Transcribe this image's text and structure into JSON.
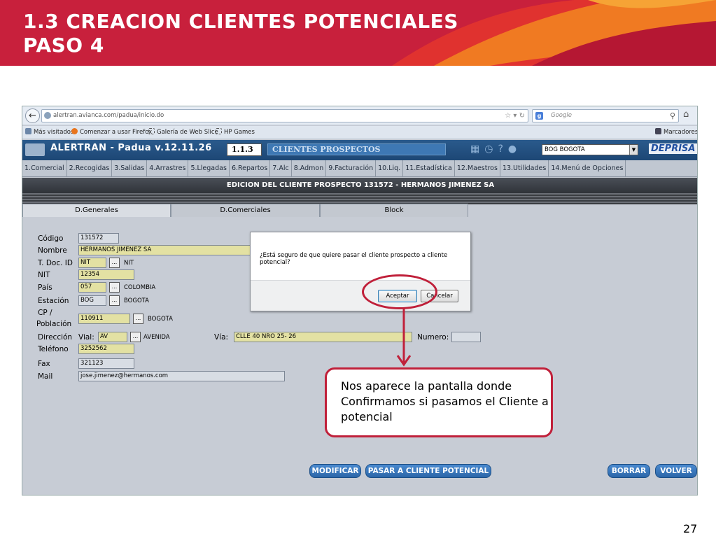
{
  "slide": {
    "title_line1": "1.3 CREACION CLIENTES POTENCIALES",
    "title_line2": "PASO 4",
    "page_number": "27",
    "annotation": "Nos aparece la pantalla donde Confirmamos si pasamos el Cliente a potencial",
    "colors": {
      "brand_red": "#c8203c",
      "orange": "#f07a22",
      "callout_border": "#c0203a"
    }
  },
  "browser": {
    "url": "alertran.avianca.com/padua/inicio.do",
    "search_placeholder": "Google",
    "bookmarks": [
      "Más visitados",
      "Comenzar a usar Firefox",
      "Galería de Web Slice",
      "HP Games"
    ],
    "bookmarks_menu": "Marcadores"
  },
  "app": {
    "title": "ALERTRAN - Padua  v.12.11.26",
    "code": "1.1.3",
    "module": "CLIENTES PROSPECTOS",
    "office": "BOG BOGOTA",
    "brand": "DEPRISA",
    "menu": [
      "1.Comercial",
      "2.Recogidas",
      "3.Salidas",
      "4.Arrastres",
      "5.Llegadas",
      "6.Repartos",
      "7.Alc",
      "8.Admon",
      "9.Facturación",
      "10.Liq.",
      "11.Estadística",
      "12.Maestros",
      "13.Utilidades",
      "14.Menú de Opciones"
    ],
    "screen_title": "EDICION DEL CLIENTE PROSPECTO 131572 - HERMANOS JIMENEZ SA",
    "tabs": [
      "D.Generales",
      "D.Comerciales",
      "Block"
    ]
  },
  "form": {
    "labels": {
      "codigo": "Código",
      "nombre": "Nombre",
      "tdoc": "T. Doc. ID",
      "nit": "NIT",
      "pais": "País",
      "estacion": "Estación",
      "cp1": "CP /",
      "cp2": "Población",
      "direccion": "Dirección",
      "vial": "Vial:",
      "via": "Vía:",
      "numero": "Numero:",
      "telefono": "Teléfono",
      "fax": "Fax",
      "mail": "Mail"
    },
    "values": {
      "codigo": "131572",
      "nombre": "HERMANOS JIMENEZ SA",
      "tdoc": "NIT",
      "tdoc_desc": "NIT",
      "nit": "12354",
      "pais": "057",
      "pais_desc": "COLOMBIA",
      "estacion": "BOG",
      "estacion_desc": "BOGOTA",
      "cp": "110911",
      "cp_desc": "BOGOTA",
      "vial": "AV",
      "vial_desc": "AVENIDA",
      "via": "CLLE 40  NRO 25- 26",
      "numero": "",
      "telefono": "3252562",
      "fax": "321123",
      "mail": "jose.jimenez@hermanos.com"
    },
    "lookup_label": "...",
    "buttons": [
      "MODIFICAR",
      "PASAR A CLIENTE POTENCIAL",
      "BORRAR",
      "VOLVER"
    ]
  },
  "dialog": {
    "message": "¿Está seguro de que quiere pasar el cliente prospecto a cliente potencial?",
    "accept": "Aceptar",
    "cancel": "Cancelar"
  }
}
